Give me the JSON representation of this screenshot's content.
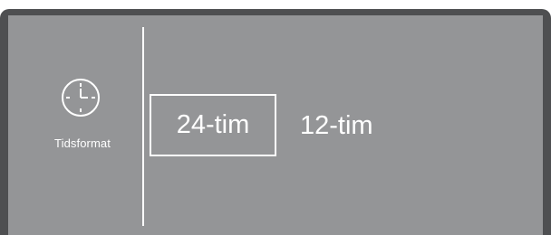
{
  "settings_panel": {
    "icon": "clock-icon",
    "label": "Tidsformat"
  },
  "options": {
    "selected_index": 0,
    "items": [
      {
        "label": "24-tim"
      },
      {
        "label": "12-tim"
      }
    ]
  },
  "colors": {
    "bezel": "#4e4f51",
    "screen": "#949597",
    "foreground": "#ffffff"
  }
}
